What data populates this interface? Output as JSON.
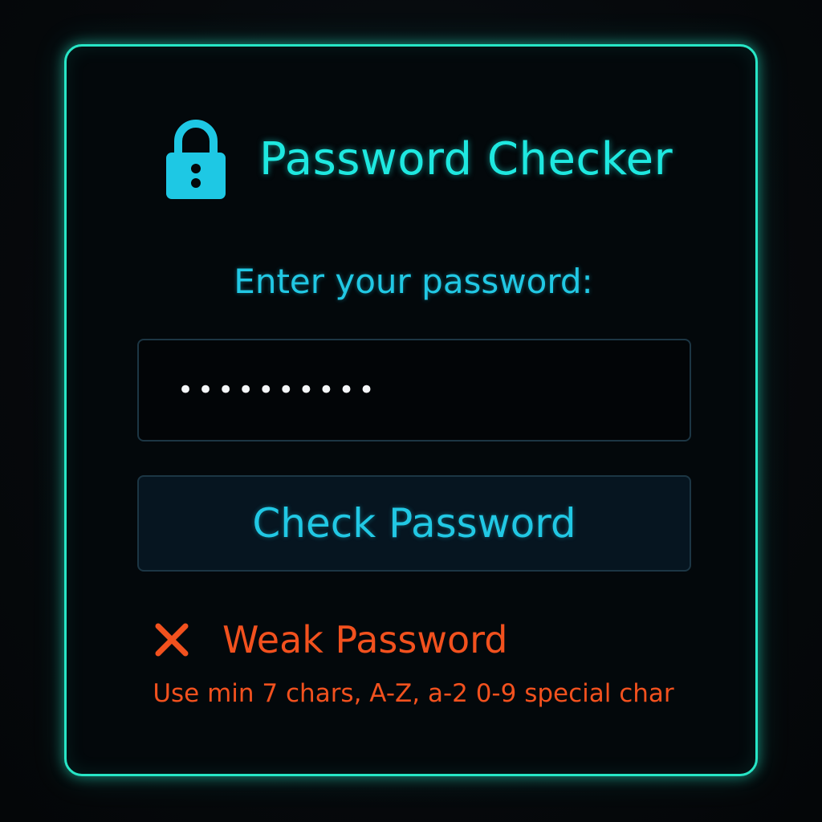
{
  "header": {
    "icon": "lock-icon",
    "title": "Password Checker"
  },
  "form": {
    "prompt": "Enter your password:",
    "password_masked": "••••••••••",
    "check_button_label": "Check Password"
  },
  "result": {
    "icon": "x-icon",
    "status": "Weak Password",
    "hint": "Use min 7 chars, A-Z, a-2 0-9 special char"
  },
  "colors": {
    "accent": "#27e6c6",
    "title": "#1ee8e0",
    "label": "#21c8e4",
    "error": "#f2511e",
    "background": "#05080b"
  }
}
